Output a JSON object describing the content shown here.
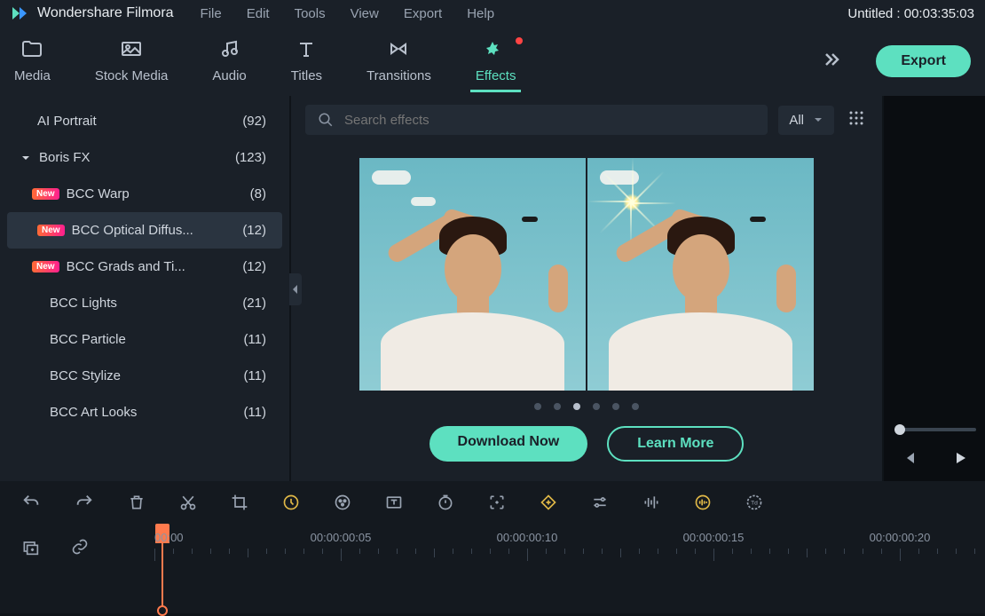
{
  "app": {
    "name": "Wondershare Filmora",
    "project_title": "Untitled : 00:03:35:03"
  },
  "menu": [
    "File",
    "Edit",
    "Tools",
    "View",
    "Export",
    "Help"
  ],
  "nav": {
    "tabs": [
      {
        "id": "media",
        "label": "Media"
      },
      {
        "id": "stock-media",
        "label": "Stock Media"
      },
      {
        "id": "audio",
        "label": "Audio"
      },
      {
        "id": "titles",
        "label": "Titles"
      },
      {
        "id": "transitions",
        "label": "Transitions"
      },
      {
        "id": "effects",
        "label": "Effects",
        "active": true,
        "has_notification": true
      }
    ],
    "export_label": "Export"
  },
  "sidebar": {
    "items": [
      {
        "label": "AI Portrait",
        "count": "(92)"
      },
      {
        "label": "Boris FX",
        "count": "(123)",
        "expandable": true,
        "expanded": true
      },
      {
        "label": "BCC Warp",
        "count": "(8)",
        "new": true,
        "child": true
      },
      {
        "label": "BCC Optical Diffus...",
        "count": "(12)",
        "new": true,
        "child": true,
        "selected": true
      },
      {
        "label": "BCC Grads and Ti...",
        "count": "(12)",
        "new": true,
        "child": true
      },
      {
        "label": "BCC Lights",
        "count": "(21)",
        "child": true
      },
      {
        "label": "BCC Particle",
        "count": "(11)",
        "child": true
      },
      {
        "label": "BCC Stylize",
        "count": "(11)",
        "child": true
      },
      {
        "label": "BCC Art Looks",
        "count": "(11)",
        "child": true
      }
    ]
  },
  "content": {
    "search_placeholder": "Search effects",
    "filter_value": "All",
    "pager_active_index": 2,
    "pager_count": 6,
    "cta_primary": "Download Now",
    "cta_secondary": "Learn More"
  },
  "timeline": {
    "labels": [
      {
        "text": "00:00",
        "pos": 0,
        "first": true
      },
      {
        "text": "00:00:00:05",
        "pos": 210
      },
      {
        "text": "00:00:00:10",
        "pos": 420
      },
      {
        "text": "00:00:00:15",
        "pos": 630
      },
      {
        "text": "00:00:00:20",
        "pos": 840
      }
    ]
  }
}
